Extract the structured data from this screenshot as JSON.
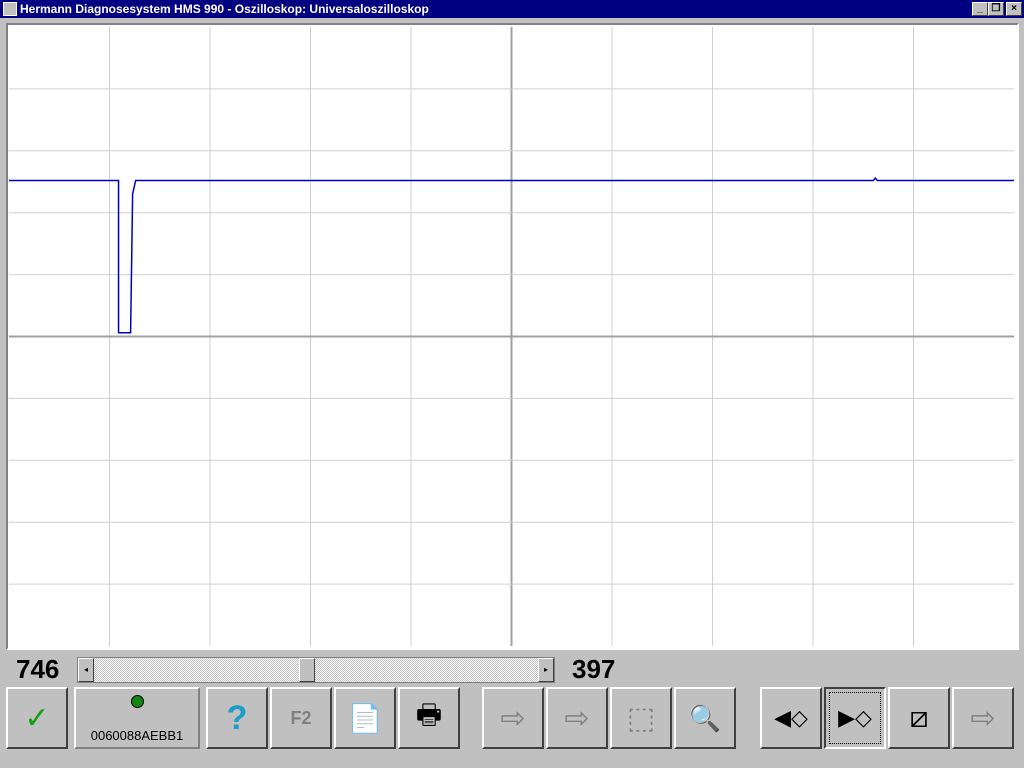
{
  "window": {
    "title": "Hermann Diagnosesystem HMS 990 - Oszilloskop: Universaloszilloskop",
    "minimize": "_",
    "restore": "❐",
    "close": "×"
  },
  "scroll": {
    "left_value": "746",
    "right_value": "397",
    "position": 0.48,
    "left_arrow": "◂",
    "right_arrow": "▸"
  },
  "toolbar": {
    "ok": "✓",
    "device_id": "0060088AEBB1",
    "led_color": "#118811",
    "help": "?",
    "f2": "F2",
    "report": "📄",
    "print": "🖶",
    "page_fwd1": "⇨",
    "page_fwd2": "⇨",
    "copy": "⬚",
    "zoom_out": "🔍",
    "cursor_left": "◀◇",
    "cursor_right": "▶◇",
    "no_cursor": "⧄",
    "exit": "⇨"
  },
  "chart_data": {
    "type": "line",
    "grid_divisions_x": 10,
    "grid_divisions_y": 10,
    "x_range": [
      0,
      10
    ],
    "y_range": [
      -5,
      5
    ],
    "trace_color": "#0000c0",
    "trace": [
      [
        0,
        2.52
      ],
      [
        1.09,
        2.52
      ],
      [
        1.09,
        0.06
      ],
      [
        1.21,
        0.06
      ],
      [
        1.23,
        2.3
      ],
      [
        1.26,
        2.52
      ],
      [
        8.6,
        2.52
      ],
      [
        8.62,
        2.56
      ],
      [
        8.64,
        2.52
      ],
      [
        10,
        2.52
      ]
    ]
  }
}
